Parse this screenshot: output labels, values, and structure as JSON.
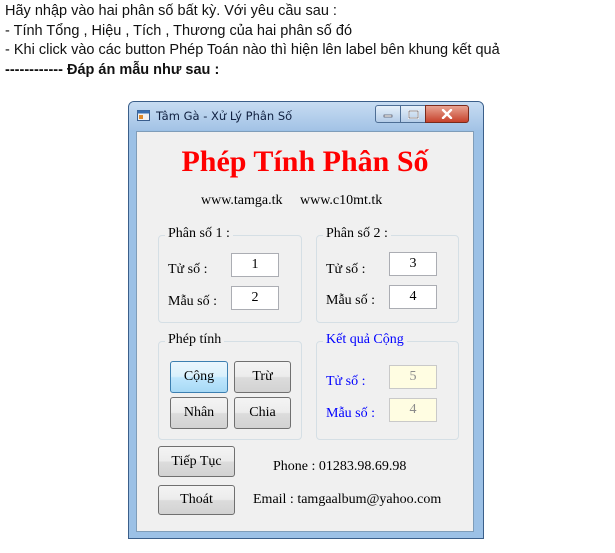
{
  "intro": {
    "line1": "Hãy nhập vào hai phân số bất kỳ. Với yêu cầu sau :",
    "line2": "- Tính Tổng , Hiệu , Tích , Thương của hai phân số đó",
    "line3": "- Khi click vào các button Phép Toán nào thì hiện lên label bên khung kết quả",
    "line4": "------------ Đáp án mẫu như sau :"
  },
  "window": {
    "title": "Tâm Gà - Xử Lý Phân Số",
    "headline": "Phép Tính Phân Số",
    "site1": "www.tamga.tk",
    "site2": "www.c10mt.tk"
  },
  "fraction1": {
    "group_label": "Phân số 1 :",
    "numerator_label": "Tử số :",
    "numerator_value": "1",
    "denominator_label": "Mẫu số :",
    "denominator_value": "2"
  },
  "fraction2": {
    "group_label": "Phân số 2 :",
    "numerator_label": "Tử số :",
    "numerator_value": "3",
    "denominator_label": "Mẫu số :",
    "denominator_value": "4"
  },
  "operations": {
    "group_label": "Phép tính",
    "add": "Cộng",
    "subtract": "Trừ",
    "multiply": "Nhân",
    "divide": "Chia"
  },
  "result": {
    "group_label": "Kết quả Cộng",
    "numerator_label": "Tử số :",
    "numerator_value": "5",
    "denominator_label": "Mẫu số :",
    "denominator_value": "4"
  },
  "footer": {
    "continue_button": "Tiếp Tục",
    "exit_button": "Thoát",
    "phone": "Phone : 01283.98.69.98",
    "email": "Email : tamgaalbum@yahoo.com"
  },
  "colors": {
    "headline": "#ff0000",
    "result_label": "#0000ff",
    "window_frame": "#9cc1e6",
    "close_button": "#c7422c"
  }
}
